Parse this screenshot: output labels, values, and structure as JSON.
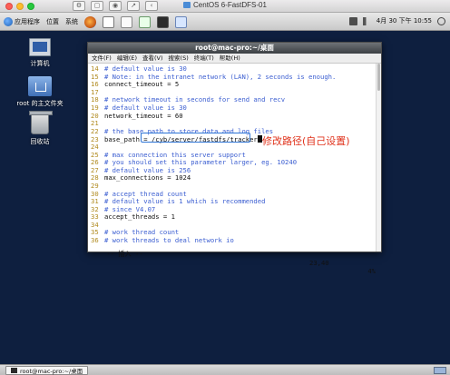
{
  "host_window": {
    "title": "CentOS 6-FastDFS-01"
  },
  "panel": {
    "menus": [
      "应用程序",
      "位置",
      "系统"
    ],
    "clock": "4月 30 下午 10:55",
    "launchers": [
      "firefox-icon",
      "mail-icon",
      "document-icon",
      "calc-icon",
      "terminal-icon",
      "image-icon"
    ]
  },
  "desktop_icons": [
    {
      "label": "计算机",
      "icon": "computer-icon"
    },
    {
      "label": "root 的主文件夹",
      "icon": "home-folder-icon"
    },
    {
      "label": "回收站",
      "icon": "trash-icon"
    }
  ],
  "terminal": {
    "title": "root@mac-pro:~/桌面",
    "menu": [
      "文件(F)",
      "编辑(E)",
      "查看(V)",
      "搜索(S)",
      "终端(T)",
      "帮助(H)"
    ],
    "lines": [
      {
        "n": "14",
        "c": "# default value is 30",
        "type": "comment"
      },
      {
        "n": "15",
        "c": "# Note: in the intranet network (LAN), 2 seconds is enough.",
        "type": "comment"
      },
      {
        "n": "16",
        "c": "connect_timeout = 5",
        "type": "text"
      },
      {
        "n": "17",
        "c": "",
        "type": "text"
      },
      {
        "n": "18",
        "c": "# network timeout in seconds for send and recv",
        "type": "comment"
      },
      {
        "n": "19",
        "c": "# default value is 30",
        "type": "comment"
      },
      {
        "n": "20",
        "c": "network_timeout = 60",
        "type": "text"
      },
      {
        "n": "21",
        "c": "",
        "type": "text"
      },
      {
        "n": "22",
        "c": "# the base path to store data and log files",
        "type": "comment"
      },
      {
        "n": "23",
        "c": "base_path = /cyb/server/fastdfs/tracker",
        "type": "cursor"
      },
      {
        "n": "24",
        "c": "",
        "type": "text"
      },
      {
        "n": "25",
        "c": "# max connection this server support",
        "type": "comment"
      },
      {
        "n": "26",
        "c": "# you should set this parameter larger, eg. 10240",
        "type": "comment"
      },
      {
        "n": "27",
        "c": "# default value is 256",
        "type": "comment"
      },
      {
        "n": "28",
        "c": "max_connections = 1024",
        "type": "text"
      },
      {
        "n": "29",
        "c": "",
        "type": "text"
      },
      {
        "n": "30",
        "c": "# accept thread count",
        "type": "comment"
      },
      {
        "n": "31",
        "c": "# default value is 1 which is recommended",
        "type": "comment"
      },
      {
        "n": "32",
        "c": "# since V4.07",
        "type": "comment"
      },
      {
        "n": "33",
        "c": "accept_threads = 1",
        "type": "text"
      },
      {
        "n": "34",
        "c": "",
        "type": "text"
      },
      {
        "n": "35",
        "c": "# work thread count",
        "type": "comment"
      },
      {
        "n": "36",
        "c": "# work threads to deal network io",
        "type": "comment"
      }
    ],
    "status_mode": "-- 插入 --",
    "status_pos": "23,40",
    "status_pct": "4%"
  },
  "annotation": "修改路径(自己设置)",
  "taskbar": {
    "item_label": "root@mac-pro:~/桌面"
  },
  "colors": {
    "desktop": "#0e1f3f",
    "comment": "#3b5ed1",
    "line_number": "#b08a1e",
    "annotation": "#e0331c",
    "highlight": "#2d74d6"
  }
}
